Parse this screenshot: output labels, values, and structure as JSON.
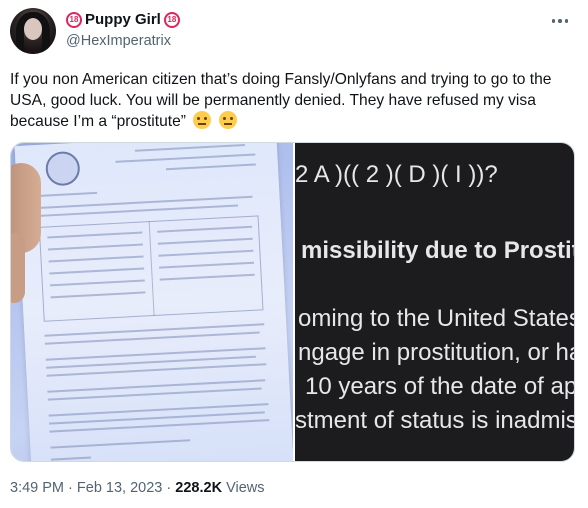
{
  "author": {
    "display_name": "Puppy Girl",
    "badge_label": "18",
    "handle": "@HexImperatrix"
  },
  "tweet": {
    "text": "If you non American citizen that’s doing Fansly/Onlyfans and trying to go to the USA, good luck. You will be permanently denied. They have refused my visa because I’m a “prostitute”",
    "emojis": [
      "face-with-raised-eyebrow",
      "expressionless-face"
    ]
  },
  "media": {
    "left_image": "photo of US embassy visa refusal letter",
    "right_lines": [
      "2 A )(( 2 )( D )( I ))?",
      "missibility due to Prostitu",
      "oming to the United States",
      "ngage in prostitution, or ha",
      "10 years of the date of app",
      "stment of status is inadmis"
    ]
  },
  "meta": {
    "time": "3:49 PM",
    "separator": "·",
    "date": "Feb 13, 2023",
    "views_count": "228.2K",
    "views_label": "Views"
  }
}
